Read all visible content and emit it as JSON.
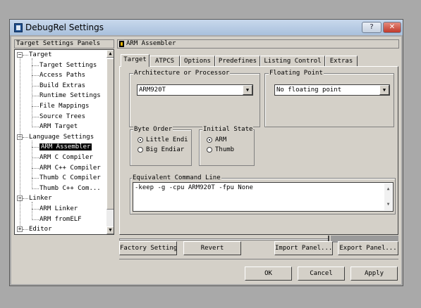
{
  "window": {
    "title": "DebugRel Settings",
    "help_label": "?",
    "close_label": "✕"
  },
  "left_panel": {
    "header": "Target Settings Panels",
    "tree": [
      {
        "label": "Target",
        "level": 0,
        "expand": "−"
      },
      {
        "label": "Target Settings",
        "level": 1
      },
      {
        "label": "Access Paths",
        "level": 1
      },
      {
        "label": "Build Extras",
        "level": 1
      },
      {
        "label": "Runtime Settings",
        "level": 1
      },
      {
        "label": "File Mappings",
        "level": 1
      },
      {
        "label": "Source Trees",
        "level": 1
      },
      {
        "label": "ARM Target",
        "level": 1
      },
      {
        "label": "Language Settings",
        "level": 0,
        "expand": "−"
      },
      {
        "label": "ARM Assembler",
        "level": 1,
        "selected": true
      },
      {
        "label": "ARM C Compiler",
        "level": 1
      },
      {
        "label": "ARM C++ Compiler",
        "level": 1
      },
      {
        "label": "Thumb C Compiler",
        "level": 1
      },
      {
        "label": "Thumb C++ Com...",
        "level": 1
      },
      {
        "label": "Linker",
        "level": 0,
        "expand": "−"
      },
      {
        "label": "ARM Linker",
        "level": 1
      },
      {
        "label": "ARM fromELF",
        "level": 1
      },
      {
        "label": "Editor",
        "level": 0,
        "expand": "+"
      }
    ]
  },
  "right_panel": {
    "header": "ARM Assembler",
    "tabs": [
      "Target",
      "ATPCS",
      "Options",
      "Predefines",
      "Listing Control",
      "Extras"
    ],
    "active_tab": "Target",
    "arch_group": {
      "label": "Architecture or Processor",
      "value": "ARM920T"
    },
    "float_group": {
      "label": "Floating Point",
      "value": "No floating point"
    },
    "byte_order": {
      "label": "Byte Order",
      "options": [
        "Little Endi",
        "Big Endiar"
      ],
      "selected": "Little Endi"
    },
    "initial_state": {
      "label": "Initial State",
      "options": [
        "ARM",
        "Thumb"
      ],
      "selected": "ARM"
    },
    "command_line": {
      "label": "Equivalent Command Line",
      "value": "-keep -g -cpu ARM920T -fpu None"
    }
  },
  "panel_buttons": {
    "factory": "Factory Settings",
    "revert": "Revert",
    "import": "Import Panel...",
    "export": "Export Panel..."
  },
  "dialog_buttons": {
    "ok": "OK",
    "cancel": "Cancel",
    "apply": "Apply"
  }
}
